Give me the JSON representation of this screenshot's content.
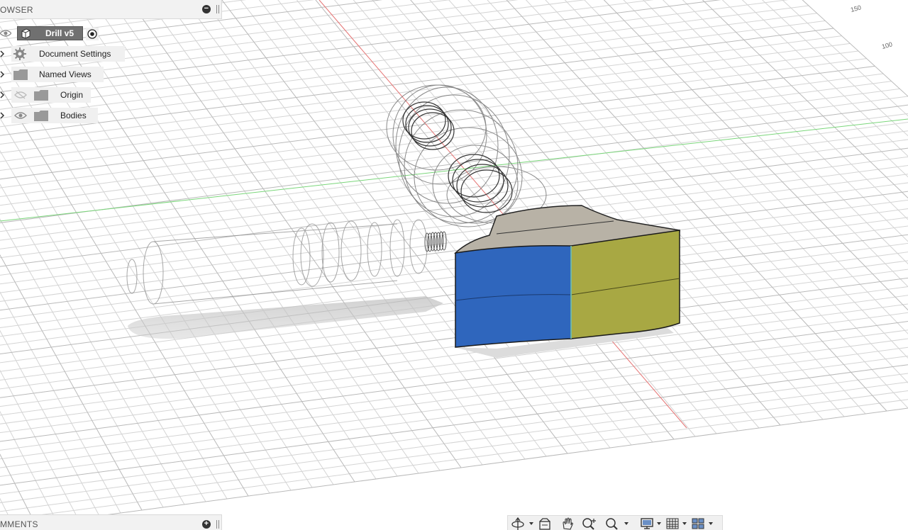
{
  "browser": {
    "title": "OWSER",
    "root": {
      "label": "Drill v5"
    },
    "items": [
      {
        "label": "Document Settings",
        "icon": "gear-icon"
      },
      {
        "label": "Named Views",
        "icon": "folder-icon"
      },
      {
        "label": "Origin",
        "icon": "folder-icon",
        "visibility": "hidden"
      },
      {
        "label": "Bodies",
        "icon": "folder-icon",
        "visibility": "visible"
      }
    ]
  },
  "comments": {
    "title": "MMENTS"
  },
  "viewport": {
    "grid_labels": [
      "150",
      "100"
    ],
    "colors": {
      "x_axis": "#e05050",
      "y_axis": "#4ccc4c",
      "face_blue": "#2f66bd",
      "face_yellow": "#a8a843",
      "face_top": "#b8b2a6"
    }
  },
  "toolbar": {
    "tools": [
      "orbit-icon",
      "look-at-icon",
      "pan-icon",
      "zoom-icon",
      "fit-icon",
      "display-settings-icon",
      "grid-settings-icon",
      "viewports-icon"
    ]
  }
}
